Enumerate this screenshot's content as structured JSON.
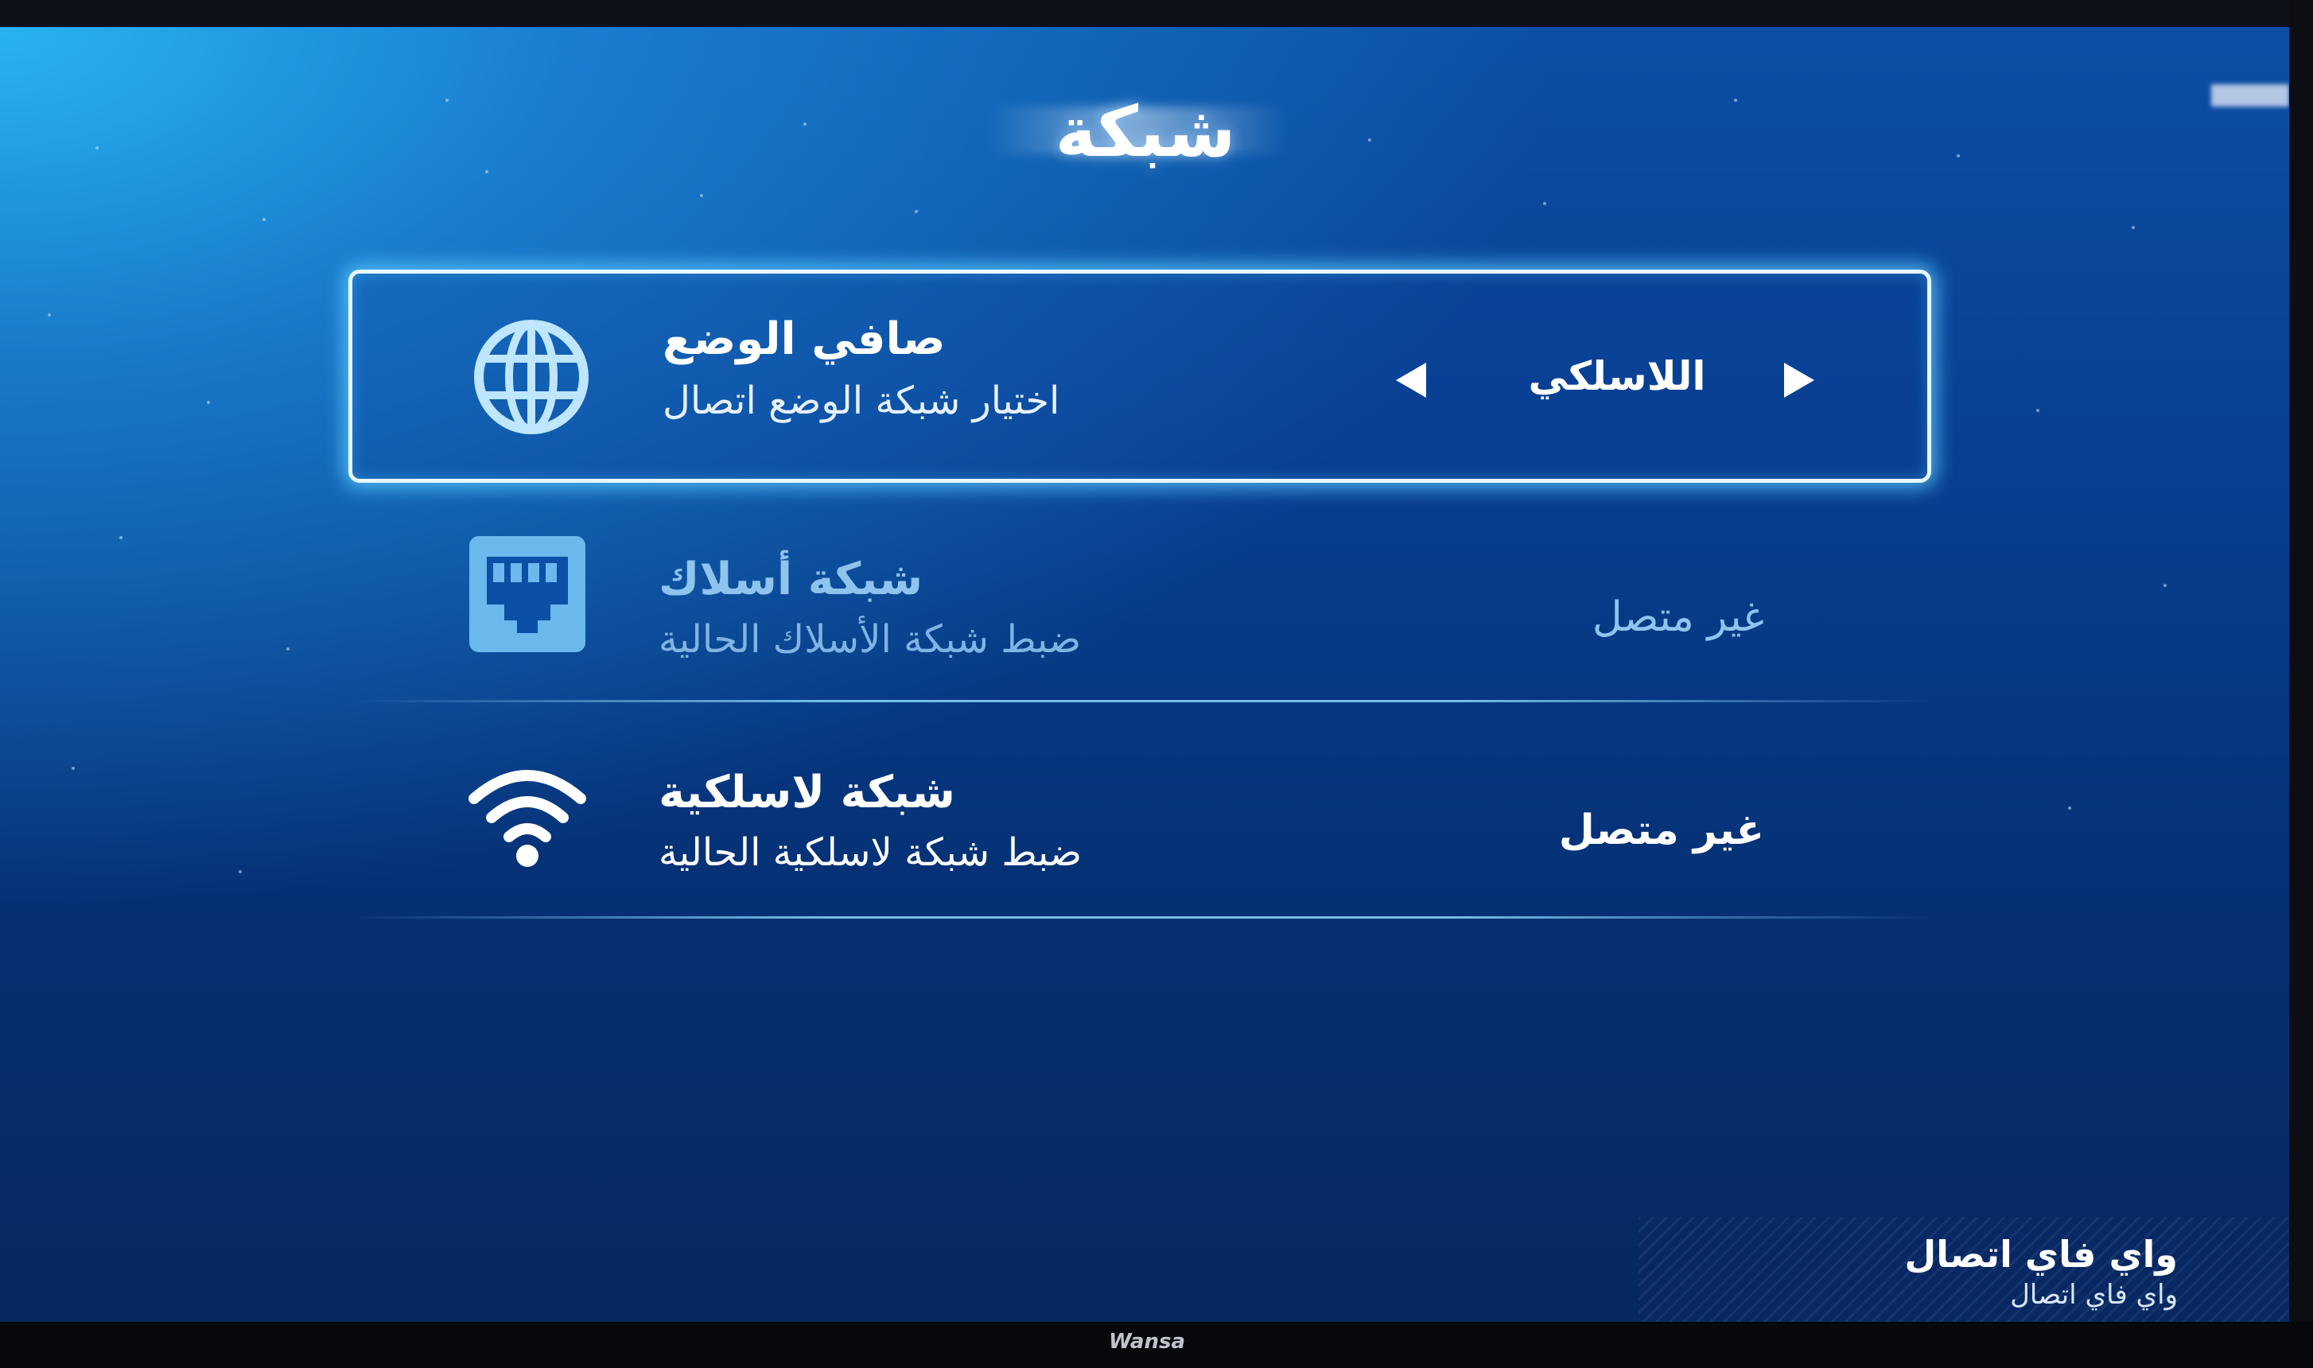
{
  "screen": {
    "title": "شبكة"
  },
  "menu": {
    "items": [
      {
        "title": "صافي الوضع",
        "subtitle": "اختيار شبكة الوضع اتصال",
        "value": "اللاسلكي",
        "icon": "globe-icon",
        "selected": true
      },
      {
        "title": "شبكة أسلاك",
        "subtitle": "ضبط شبكة الأسلاك الحالية",
        "status": "غير متصل",
        "icon": "ethernet-port-icon",
        "selected": false
      },
      {
        "title": "شبكة لاسلكية",
        "subtitle": "ضبط شبكة لاسلكية الحالية",
        "status": "غير متصل",
        "icon": "wifi-icon",
        "selected": false
      }
    ]
  },
  "hint": {
    "title": "واي فاي اتصال",
    "subtitle": "واي فاي اتصال"
  },
  "bezel": {
    "brand": "Wansa"
  },
  "colors": {
    "focus_border": "#e8f7ff",
    "focus_glow": "#5ac8ff",
    "dim_text": "#8fc4ee",
    "accent": "#7fd0ff"
  }
}
